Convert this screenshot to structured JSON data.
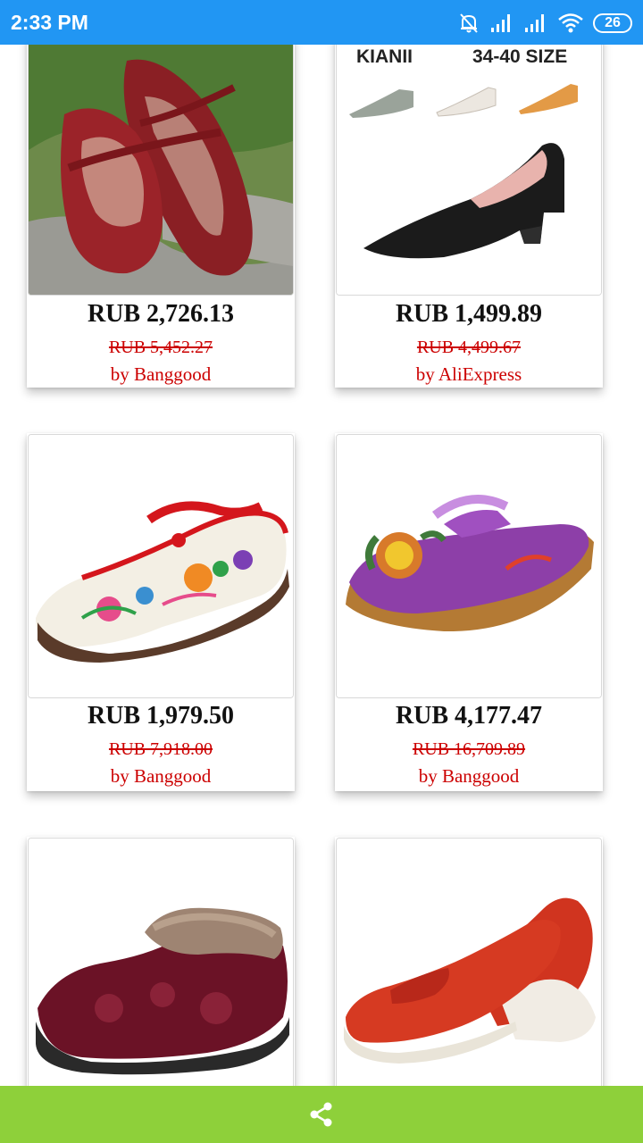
{
  "status_bar": {
    "time": "2:33 PM",
    "battery_level": "26",
    "icons": [
      "alarm-off-icon",
      "signal-icon",
      "signal-icon",
      "wifi-icon",
      "battery-icon"
    ]
  },
  "products": [
    {
      "price": "RUB 2,726.13",
      "old_price": "RUB 5,452.27",
      "seller": "by Banggood",
      "image": "red-leather-mary-jane-flats"
    },
    {
      "price": "RUB 1,499.89",
      "old_price": "RUB 4,499.67",
      "seller": "by AliExpress",
      "image": "black-pointed-block-heel-pump",
      "image_text": {
        "brand": "KIANII",
        "size": "34-40 SIZE"
      }
    },
    {
      "price": "RUB 1,979.50",
      "old_price": "RUB 7,918.00",
      "seller": "by Banggood",
      "image": "embroidered-white-flat"
    },
    {
      "price": "RUB 4,177.47",
      "old_price": "RUB 16,709.89",
      "seller": "by Banggood",
      "image": "purple-flower-platform-clog"
    },
    {
      "image": "burgundy-velvet-fur-slipper"
    },
    {
      "image": "red-leather-loafer"
    }
  ],
  "bottom_bar": {
    "icon": "share-icon",
    "color": "#8ed03a"
  },
  "colors": {
    "status_bar": "#2196f3",
    "price_old": "#cc0000",
    "seller": "#cc0000"
  }
}
